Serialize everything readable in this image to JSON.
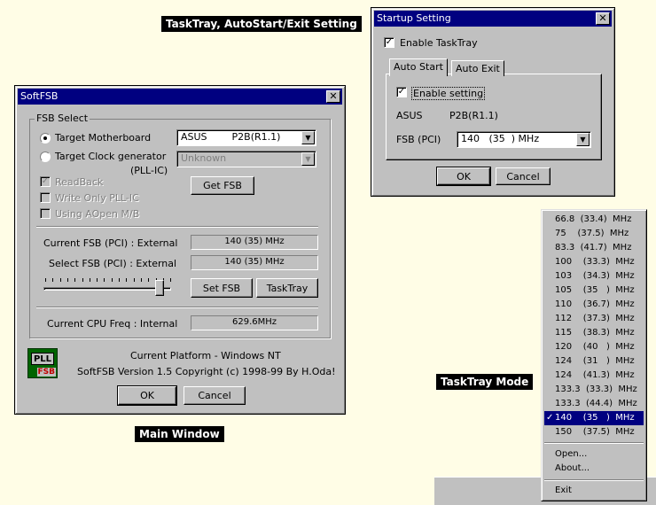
{
  "captions": {
    "tasktray_setting": "TaskTray, AutoStart/Exit Setting",
    "main_window": "Main Window",
    "tasktray_mode": "TaskTray Mode"
  },
  "main": {
    "title": "SoftFSB",
    "close": "✕",
    "group_title": "FSB Select",
    "radio_motherboard": "Target Motherboard",
    "radio_clockgen": "Target Clock generator",
    "pll_ic": "(PLL-IC)",
    "motherboard_value": "ASUS        P2B(R1.1)",
    "clockgen_value": "Unknown",
    "chk_readback": "ReadBack",
    "chk_writeonly": "Write Only PLL-IC",
    "chk_aopen": "Using AOpen M/B",
    "get_fsb": "Get FSB",
    "current_fsb_label": "Current FSB (PCI) : External",
    "current_fsb_value": "140 (35) MHz",
    "select_fsb_label": "Select FSB (PCI) : External",
    "select_fsb_value": "140 (35) MHz",
    "set_fsb": "Set FSB",
    "tasktray": "TaskTray",
    "cpu_freq_label": "Current CPU Freq : Internal",
    "cpu_freq_value": "629.6MHz",
    "logo_top": "PLL",
    "logo_bottom": "FSB",
    "platform": "Current Platform - Windows NT",
    "version": "SoftFSB Version 1.5  Copyright (c) 1998-99 By H.Oda!",
    "ok": "OK",
    "cancel": "Cancel"
  },
  "startup": {
    "title": "Startup Setting",
    "close": "✕",
    "enable_tasktray": "Enable TaskTray",
    "tab_autostart": "Auto Start",
    "tab_autoexit": "Auto Exit",
    "enable_setting": "Enable setting",
    "brand": "ASUS",
    "model": "P2B(R1.1)",
    "fsb_label": "FSB (PCI)",
    "fsb_value": "140   (35  ) MHz",
    "ok": "OK",
    "cancel": "Cancel"
  },
  "menu": {
    "items": [
      "66.8  (33.4)  MHz",
      "75    (37.5)  MHz",
      "83.3  (41.7)  MHz",
      "100    (33.3)  MHz",
      "103    (34.3)  MHz",
      "105    (35   )  MHz",
      "110    (36.7)  MHz",
      "112    (37.3)  MHz",
      "115    (38.3)  MHz",
      "120    (40   )  MHz",
      "124    (31   )  MHz",
      "124    (41.3)  MHz",
      "133.3  (33.3)  MHz",
      "133.3  (44.4)  MHz",
      "140    (35   )  MHz",
      "150    (37.5)  MHz"
    ],
    "selected_index": 14,
    "check_mark": "✓",
    "open": "Open...",
    "about": "About...",
    "exit": "Exit"
  }
}
